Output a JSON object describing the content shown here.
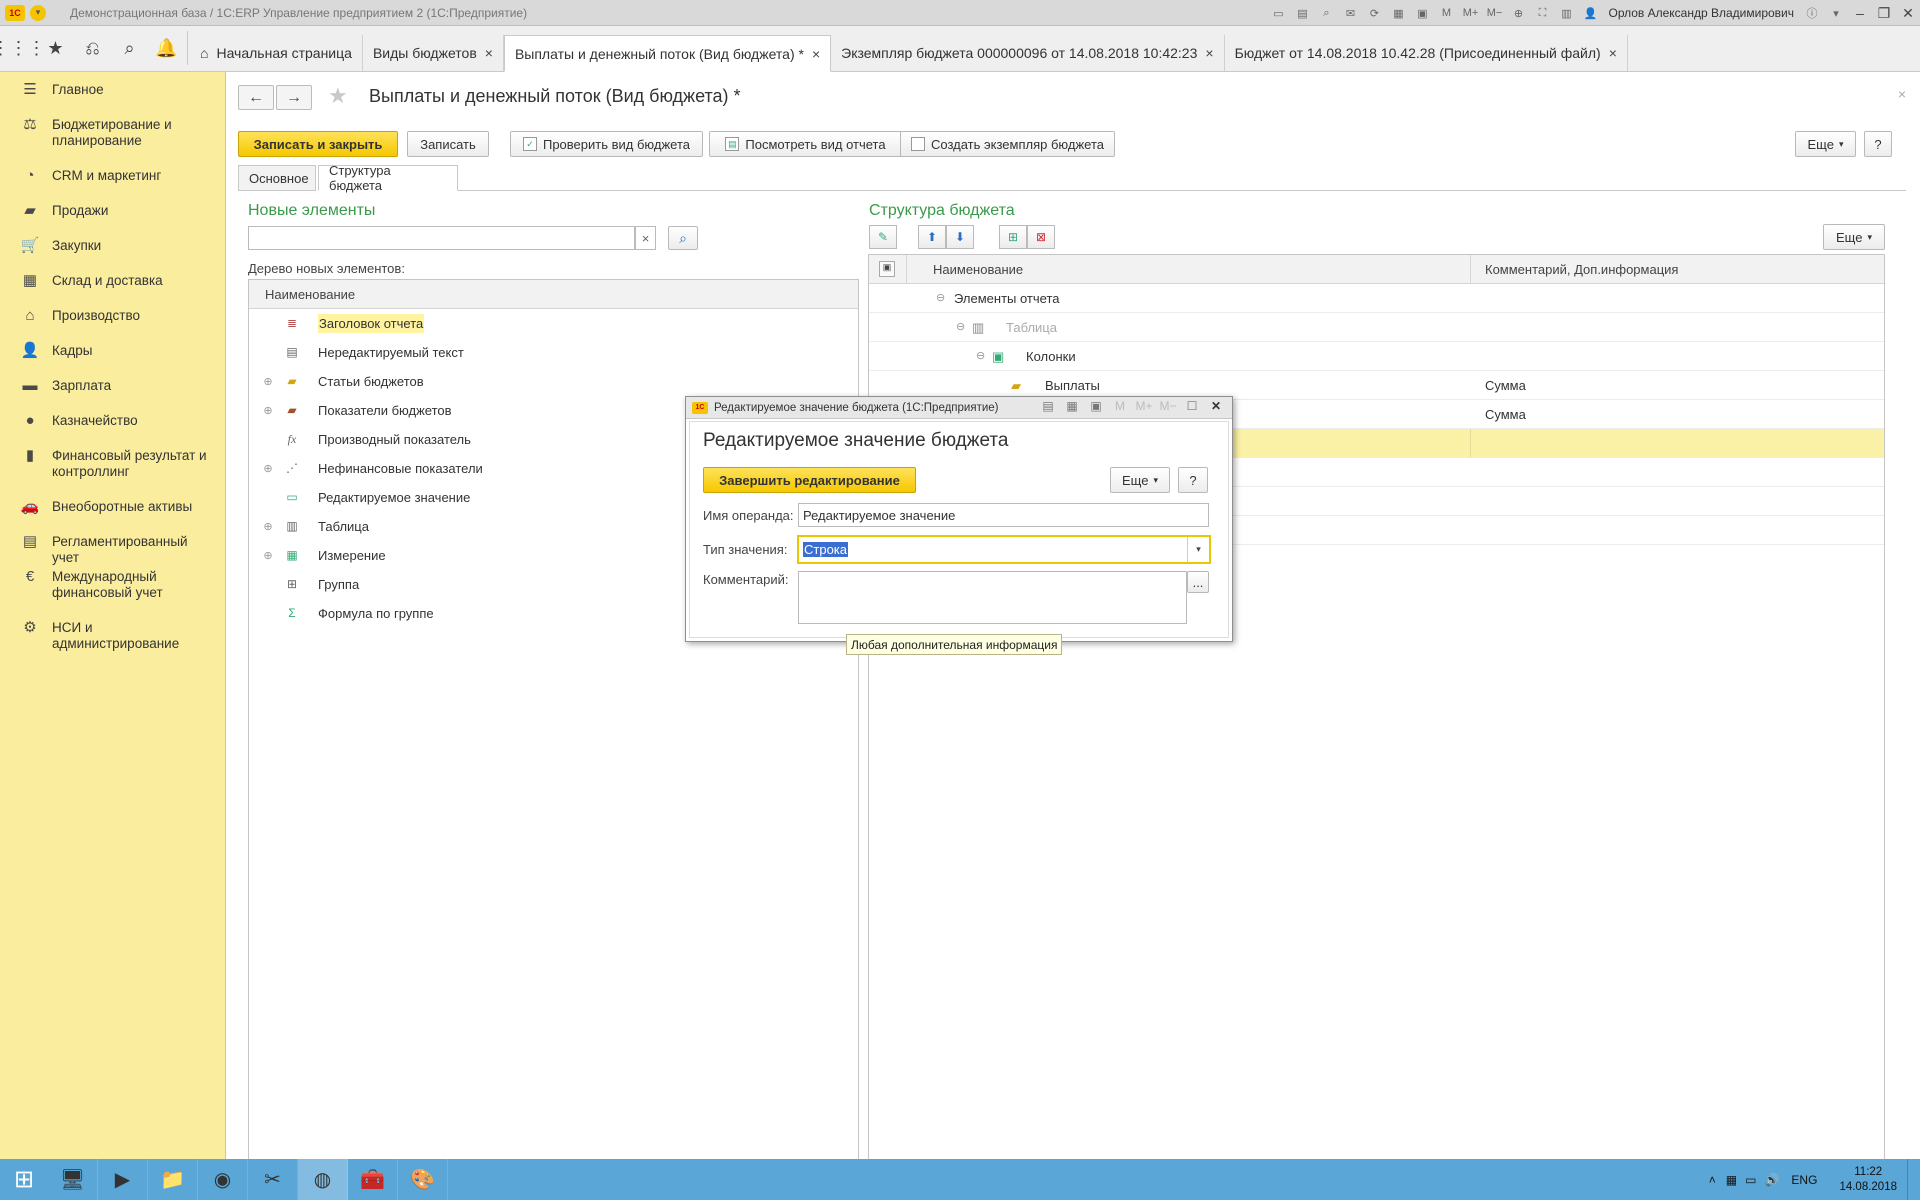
{
  "window": {
    "title": "Демонстрационная база / 1С:ERP Управление предприятием 2  (1С:Предприятие)",
    "user": "Орлов Александр Владимирович",
    "logo_text": "1С"
  },
  "tabs": [
    {
      "label": "Начальная страница",
      "closable": false
    },
    {
      "label": "Виды  бюджетов",
      "closable": true
    },
    {
      "label": "Выплаты и денежный поток (Вид бюджета) *",
      "closable": true,
      "active": true
    },
    {
      "label": "Экземпляр бюджета 000000096 от 14.08.2018 10:42:23",
      "closable": true
    },
    {
      "label": "Бюджет от 14.08.2018 10.42.28 (Присоединенный файл)",
      "closable": true
    }
  ],
  "sidebar": {
    "items": [
      {
        "label": "Главное",
        "icon": "menu-icon"
      },
      {
        "label": "Бюджетирование и планирование",
        "icon": "budget-icon"
      },
      {
        "label": "CRM и маркетинг",
        "icon": "pie-chart-icon"
      },
      {
        "label": "Продажи",
        "icon": "shopping-bag-icon"
      },
      {
        "label": "Закупки",
        "icon": "cart-icon"
      },
      {
        "label": "Склад и доставка",
        "icon": "warehouse-icon"
      },
      {
        "label": "Производство",
        "icon": "factory-icon"
      },
      {
        "label": "Кадры",
        "icon": "person-icon"
      },
      {
        "label": "Зарплата",
        "icon": "wallet-icon"
      },
      {
        "label": "Казначейство",
        "icon": "coin-icon"
      },
      {
        "label": "Финансовый результат и контроллинг",
        "icon": "chart-icon"
      },
      {
        "label": "Внеоборотные активы",
        "icon": "car-icon"
      },
      {
        "label": "Регламентированный учет",
        "icon": "ledger-icon"
      },
      {
        "label": "Международный финансовый учет",
        "icon": "euro-icon"
      },
      {
        "label": "НСИ и администрирование",
        "icon": "gear-icon"
      }
    ]
  },
  "form": {
    "title": "Выплаты и денежный поток (Вид бюджета) *",
    "buttons": {
      "save_close": "Записать и закрыть",
      "save": "Записать",
      "check": "Проверить вид бюджета",
      "view_report": "Посмотреть вид отчета",
      "create_instance": "Создать экземпляр бюджета",
      "more": "Еще",
      "help": "?"
    },
    "form_tabs": [
      "Основное",
      "Структура бюджета"
    ],
    "left": {
      "title": "Новые элементы",
      "search_value": "",
      "search_clear": "×",
      "tree_label": "Дерево новых элементов:",
      "column": "Наименование",
      "items": [
        {
          "label": "Заголовок отчета",
          "icon": "report-header-icon",
          "expandable": false,
          "highlighted": true
        },
        {
          "label": "Нередактируемый текст",
          "icon": "text-icon",
          "expandable": false
        },
        {
          "label": "Статьи бюджетов",
          "icon": "folder-icon",
          "expandable": true
        },
        {
          "label": "Показатели бюджетов",
          "icon": "indicators-icon",
          "expandable": true
        },
        {
          "label": "Производный показатель",
          "icon": "function-icon",
          "expandable": false
        },
        {
          "label": "Нефинансовые показатели",
          "icon": "nonfinancial-icon",
          "expandable": true
        },
        {
          "label": "Редактируемое значение",
          "icon": "editable-value-icon",
          "expandable": false
        },
        {
          "label": "Таблица",
          "icon": "table-icon",
          "expandable": true
        },
        {
          "label": "Измерение",
          "icon": "dimension-icon",
          "expandable": true
        },
        {
          "label": "Группа",
          "icon": "group-icon",
          "expandable": false
        },
        {
          "label": "Формула по группе",
          "icon": "group-formula-icon",
          "expandable": false
        }
      ]
    },
    "right": {
      "title": "Структура бюджета",
      "more": "Еще",
      "columns": [
        "Наименование",
        "Комментарий, Доп.информация"
      ],
      "rows": [
        {
          "name": "Элементы отчета",
          "comment": "",
          "level": 0,
          "toggle": "⊖"
        },
        {
          "name": "Таблица",
          "comment": "",
          "level": 1,
          "toggle": "⊖",
          "dim": true
        },
        {
          "name": "Колонки",
          "comment": "",
          "level": 2,
          "toggle": "⊖"
        },
        {
          "name": "Выплаты",
          "comment": "Сумма",
          "level": 3,
          "toggle": ""
        },
        {
          "name": "",
          "comment": "Сумма",
          "level": 3,
          "toggle": ""
        },
        {
          "name": "",
          "comment": "",
          "level": 3,
          "toggle": "",
          "selected": true
        },
        {
          "name": "",
          "comment": "",
          "level": 3,
          "toggle": ""
        },
        {
          "name": "",
          "comment": "",
          "level": 3,
          "toggle": ""
        },
        {
          "name": "",
          "comment": "",
          "level": 3,
          "toggle": ""
        }
      ]
    }
  },
  "modal": {
    "window_title": "Редактируемое значение бюджета  (1С:Предприятие)",
    "heading": "Редактируемое значение бюджета",
    "finish_button": "Завершить редактирование",
    "more": "Еще",
    "help": "?",
    "operand_label": "Имя операнда:",
    "operand_value": "Редактируемое значение",
    "type_label": "Тип значения:",
    "type_value": "Строка",
    "comment_label": "Комментарий:",
    "comment_value": "",
    "comment_button": "...",
    "tooltip": "Любая дополнительная информация"
  },
  "taskbar": {
    "language": "ENG",
    "time": "11:22",
    "date": "14.08.2018"
  },
  "colors": {
    "sidebar_bg": "#fbed9e",
    "accent_yellow": "#f5c800",
    "section_title_green": "#3a9a4a",
    "taskbar_blue": "#5aa6d6"
  }
}
